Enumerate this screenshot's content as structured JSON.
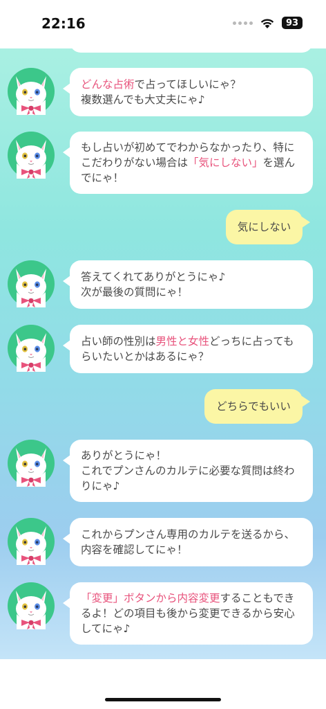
{
  "status_bar": {
    "time": "22:16",
    "battery": "93"
  },
  "colors": {
    "accent_pink": "#e8537c",
    "bot_bubble": "#ffffff",
    "user_bubble": "#fbf6a5",
    "avatar_ring": "#3cc78a"
  },
  "icons": {
    "wifi": "wifi-icon",
    "signal": "signal-dots-icon",
    "avatar": "white-cat-with-bow-icon"
  },
  "messages": [
    {
      "sender": "bot",
      "lines": [
        [
          {
            "t": "どんな占術",
            "pink": true
          },
          {
            "t": "で占ってほしいにゃ？"
          }
        ],
        [
          {
            "t": "複数選んでも大丈夫にゃ♪"
          }
        ]
      ]
    },
    {
      "sender": "bot",
      "lines": [
        [
          {
            "t": "もし占いが初めてでわからなかったり、特に"
          }
        ],
        [
          {
            "t": "こだわりがない場合は"
          },
          {
            "t": "「気にしない」",
            "pink": true
          },
          {
            "t": "を選ん"
          }
        ],
        [
          {
            "t": "でにゃ！"
          }
        ]
      ]
    },
    {
      "sender": "user",
      "text": "気にしない"
    },
    {
      "sender": "bot",
      "lines": [
        [
          {
            "t": "答えてくれてありがとうにゃ♪"
          }
        ],
        [
          {
            "t": "次が最後の質問にゃ！"
          }
        ]
      ]
    },
    {
      "sender": "bot",
      "lines": [
        [
          {
            "t": "占い師の性別は"
          },
          {
            "t": "男性と女性",
            "pink": true
          },
          {
            "t": "どっちに占っても"
          }
        ],
        [
          {
            "t": "らいたいとかはあるにゃ？"
          }
        ]
      ]
    },
    {
      "sender": "user",
      "text": "どちらでもいい"
    },
    {
      "sender": "bot",
      "lines": [
        [
          {
            "t": "ありがとうにゃ！"
          }
        ],
        [
          {
            "t": "これでプンさんのカルテに必要な質問は終わ"
          }
        ],
        [
          {
            "t": "りにゃ♪"
          }
        ]
      ]
    },
    {
      "sender": "bot",
      "lines": [
        [
          {
            "t": "これからプンさん専用のカルテを送るから、"
          }
        ],
        [
          {
            "t": "内容を確認してにゃ！"
          }
        ]
      ]
    },
    {
      "sender": "bot",
      "lines": [
        [
          {
            "t": "「変更」ボタンから内容変更",
            "pink": true
          },
          {
            "t": "することもでき"
          }
        ],
        [
          {
            "t": "るよ！どの項目も後から変更できるから安心"
          }
        ],
        [
          {
            "t": "してにゃ♪"
          }
        ]
      ]
    }
  ]
}
